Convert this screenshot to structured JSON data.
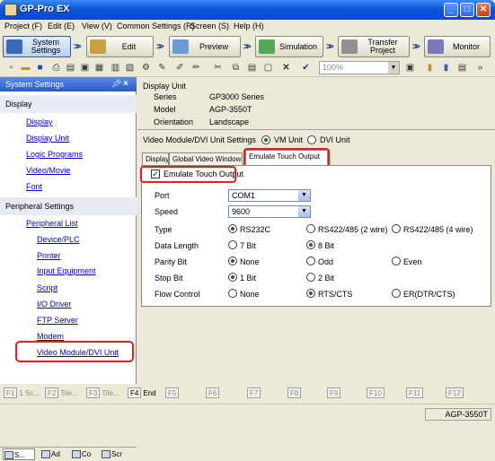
{
  "window": {
    "title": "GP-Pro EX"
  },
  "menu": [
    {
      "label": "Project (F)"
    },
    {
      "label": "Edit (E)"
    },
    {
      "label": "View (V)"
    },
    {
      "label": "Common Settings (R)"
    },
    {
      "label": "Screen (S)"
    },
    {
      "label": "Help (H)"
    }
  ],
  "workflow": [
    {
      "label": "System Settings",
      "active": true
    },
    {
      "label": "Edit"
    },
    {
      "label": "Preview"
    },
    {
      "label": "Simulation"
    },
    {
      "label": "Transfer Project"
    },
    {
      "label": "Monitor"
    }
  ],
  "toolbar": {
    "zoom": "100%"
  },
  "system_settings": {
    "title": "System Settings",
    "sections": [
      {
        "label": "Display",
        "items": [
          "Display",
          "Display Unit",
          "Logic Programs",
          "Video/Movie",
          "Font"
        ]
      },
      {
        "label": "Peripheral Settings",
        "items": [
          "Peripheral List",
          "Device/PLC",
          "Printer",
          "Input Equipment",
          "Script",
          "I/O Driver",
          "FTP Server",
          "Modem",
          "Video Module/DVI Unit"
        ]
      }
    ],
    "bottom_tabs": [
      "S...",
      "Ad",
      "Co",
      "Scr"
    ]
  },
  "display_unit": {
    "heading": "Display Unit",
    "rows": [
      {
        "label": "Series",
        "value": "GP3000 Series"
      },
      {
        "label": "Model",
        "value": "AGP-3550T"
      },
      {
        "label": "Orientation",
        "value": "Landscape"
      }
    ]
  },
  "video_settings": {
    "label": "Video Module/DVI Unit Settings",
    "options": [
      {
        "label": "VM Unit",
        "selected": true
      },
      {
        "label": "DVI Unit",
        "selected": false
      }
    ]
  },
  "tabs": [
    {
      "label": "Display"
    },
    {
      "label": "Global Video Window"
    },
    {
      "label": "Emulate Touch Output",
      "active": true
    }
  ],
  "emulate": {
    "checkbox_label": "Emulate Touch Output",
    "checked": true,
    "port_label": "Port",
    "port_value": "COM1",
    "speed_label": "Speed",
    "speed_value": "9600",
    "type": {
      "label": "Type",
      "options": [
        "RS232C",
        "RS422/485 (2 wire)",
        "RS422/485 (4 wire)"
      ],
      "selected": 0
    },
    "data_length": {
      "label": "Data Length",
      "options": [
        "7 Bit",
        "8 Bit"
      ],
      "selected": 1
    },
    "parity": {
      "label": "Parity Bit",
      "options": [
        "None",
        "Odd",
        "Even"
      ],
      "selected": 0
    },
    "stop_bit": {
      "label": "Stop Bit",
      "options": [
        "1 Bit",
        "2 Bit"
      ],
      "selected": 0
    },
    "flow": {
      "label": "Flow Control",
      "options": [
        "None",
        "RTS/CTS",
        "ER(DTR/CTS)"
      ],
      "selected": 1
    }
  },
  "function_keys": [
    {
      "key": "F1",
      "label": "1 Sc..."
    },
    {
      "key": "F2",
      "label": "Tile..."
    },
    {
      "key": "F3",
      "label": "Tile..."
    },
    {
      "key": "F4",
      "label": "End",
      "enabled": true
    },
    {
      "key": "F5",
      "label": ""
    },
    {
      "key": "F6",
      "label": ""
    },
    {
      "key": "F7",
      "label": ""
    },
    {
      "key": "F8",
      "label": ""
    },
    {
      "key": "F9",
      "label": ""
    },
    {
      "key": "F10",
      "label": ""
    },
    {
      "key": "F11",
      "label": ""
    },
    {
      "key": "F12",
      "label": ""
    }
  ],
  "status": {
    "model": "AGP-3550T"
  }
}
